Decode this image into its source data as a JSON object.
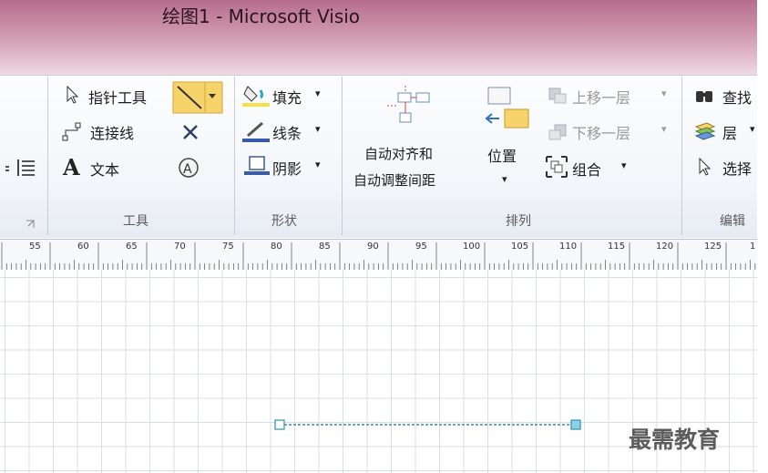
{
  "window": {
    "title": "绘图1 - Microsoft Visio"
  },
  "ribbon": {
    "tools": {
      "group_label": "工具",
      "pointer_tool": "指针工具",
      "connector": "连接线",
      "text": "文本"
    },
    "shape": {
      "group_label": "形状",
      "fill": "填充",
      "line": "线条",
      "shadow": "阴影"
    },
    "arrange": {
      "group_label": "排列",
      "auto_align_line1": "自动对齐和",
      "auto_align_line2": "自动调整间距",
      "position": "位置",
      "bring_forward": "上移一层",
      "send_backward": "下移一层",
      "group": "组合"
    },
    "editing": {
      "group_label": "编辑",
      "find": "查找",
      "layers": "层",
      "select": "选择"
    }
  },
  "ruler": {
    "labels": [
      "55",
      "60",
      "65",
      "70",
      "75",
      "80",
      "85",
      "90",
      "95",
      "100",
      "105",
      "110",
      "115",
      "120",
      "125",
      "1"
    ]
  },
  "watermark": "最需教育",
  "colors": {
    "accent": "#f6d36b",
    "line": "#2f8fb6"
  }
}
